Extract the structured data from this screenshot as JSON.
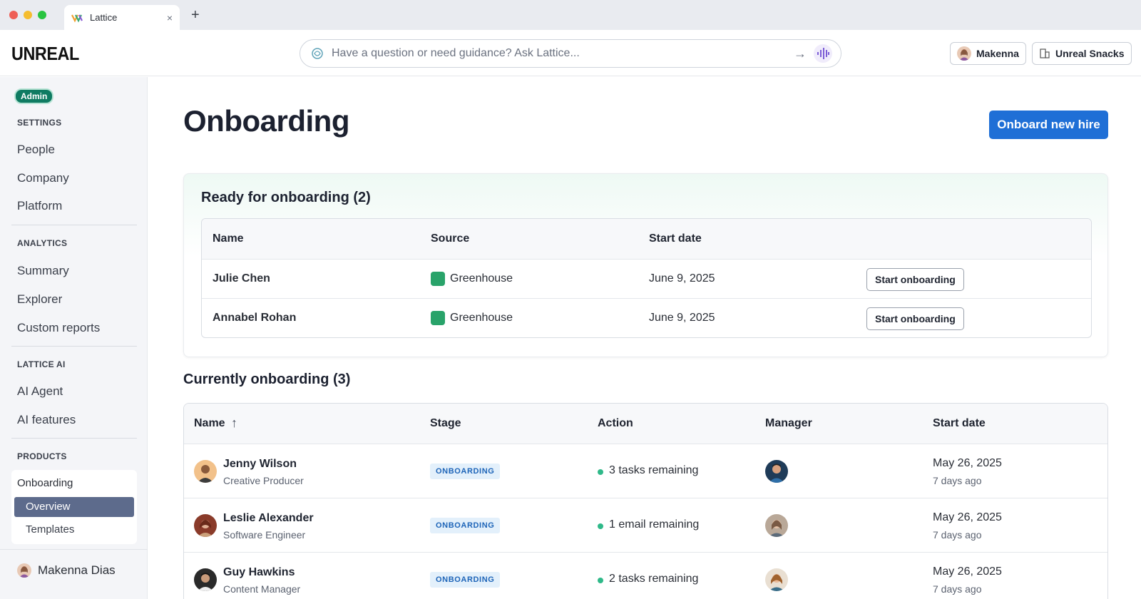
{
  "browser": {
    "tab_title": "Lattice",
    "tab_close": "×",
    "new_tab": "+"
  },
  "topbar": {
    "logo": "UNREAL",
    "ask_placeholder": "Have a question or need guidance? Ask Lattice...",
    "ask_arrow": "→",
    "user_name": "Makenna",
    "org_name": "Unreal Snacks"
  },
  "sidebar": {
    "badge": "Admin",
    "sections": {
      "settings": "SETTINGS",
      "analytics": "ANALYTICS",
      "lattice_ai": "LATTICE AI",
      "products": "PRODUCTS"
    },
    "settings_items": [
      "People",
      "Company",
      "Platform"
    ],
    "analytics_items": [
      "Summary",
      "Explorer",
      "Custom reports"
    ],
    "ai_items": [
      "AI Agent",
      "AI features"
    ],
    "products": {
      "onboarding": "Onboarding",
      "overview": "Overview",
      "templates": "Templates"
    },
    "footer_user": "Makenna Dias"
  },
  "main": {
    "title": "Onboard­ing",
    "primary_button": "Onboard new hire",
    "ready": {
      "title": "Ready for onboarding (2)",
      "headers": [
        "Name",
        "Source",
        "Start date"
      ],
      "rows": [
        {
          "name": "Julie Chen",
          "source": "Greenhouse",
          "start": "June 9, 2025",
          "action": "Start onboarding"
        },
        {
          "name": "Annabel Rohan",
          "source": "Greenhouse",
          "start": "June 9, 2025",
          "action": "Start onboarding"
        }
      ]
    },
    "current": {
      "title": "Currently onboarding (3)",
      "headers": [
        "Name",
        "Stage",
        "Action",
        "Manager",
        "Start date"
      ],
      "sort_arrow": "↑",
      "rows": [
        {
          "name": "Jenny Wilson",
          "role": "Creative Producer",
          "stage": "ONBOARDING",
          "action": "3 tasks remaining",
          "start": "May 26, 2025",
          "ago": "7 days ago"
        },
        {
          "name": "Leslie Alexander",
          "role": "Software Engineer",
          "stage": "ONBOARDING",
          "action": "1 email remaining",
          "start": "May 26, 2025",
          "ago": "7 days ago"
        },
        {
          "name": "Guy Hawkins",
          "role": "Content Manager",
          "stage": "ONBOARDING",
          "action": "2 tasks remaining",
          "start": "May 26, 2025",
          "ago": "7 days ago"
        }
      ]
    }
  },
  "colors": {
    "primary": "#1f6fd6",
    "admin_badge": "#0f7b62",
    "nav_selected": "#5d6b8c",
    "stage_badge_bg": "#e3f0fb",
    "action_dot": "#2fb989",
    "greenhouse": "#29a36a"
  }
}
